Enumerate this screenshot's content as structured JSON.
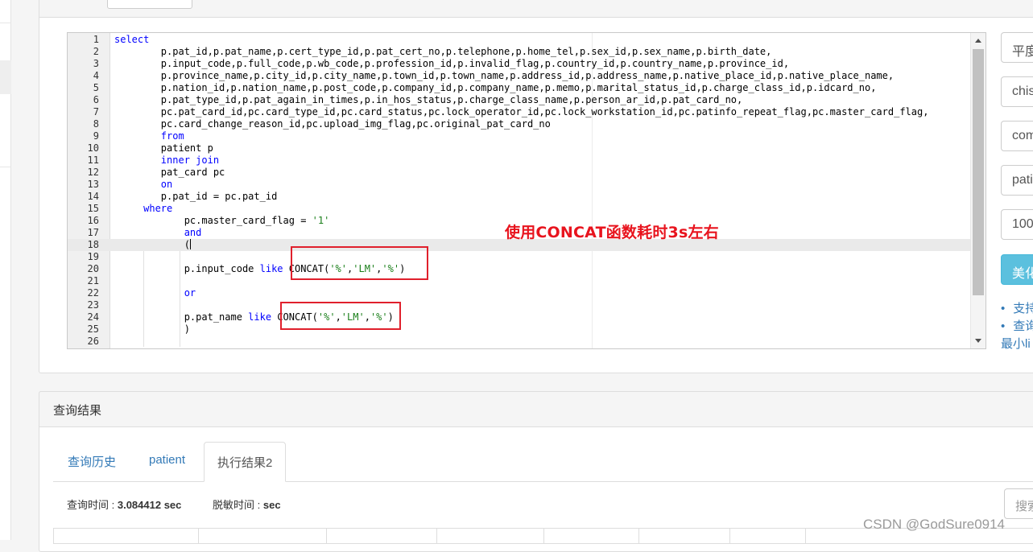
{
  "editor": {
    "lines": [
      {
        "num": "1",
        "tokens": [
          {
            "t": "kw",
            "v": "select"
          }
        ]
      },
      {
        "num": "2",
        "tokens": [
          {
            "t": "plain",
            "v": "        p.pat_id,p.pat_name,p.cert_type_id,p.pat_cert_no,p.telephone,p.home_tel,p.sex_id,p.sex_name,p.birth_date,"
          }
        ]
      },
      {
        "num": "3",
        "tokens": [
          {
            "t": "plain",
            "v": "        p.input_code,p.full_code,p.wb_code,p.profession_id,p.invalid_flag,p.country_id,p.country_name,p.province_id,"
          }
        ]
      },
      {
        "num": "4",
        "tokens": [
          {
            "t": "plain",
            "v": "        p.province_name,p.city_id,p.city_name,p.town_id,p.town_name,p.address_id,p.address_name,p.native_place_id,p.native_place_name,"
          }
        ]
      },
      {
        "num": "5",
        "tokens": [
          {
            "t": "plain",
            "v": "        p.nation_id,p.nation_name,p.post_code,p.company_id,p.company_name,p.memo,p.marital_status_id,p.charge_class_id,p.idcard_no,"
          }
        ]
      },
      {
        "num": "6",
        "tokens": [
          {
            "t": "plain",
            "v": "        p.pat_type_id,p.pat_again_in_times,p.in_hos_status,p.charge_class_name,p.person_ar_id,p.pat_card_no,"
          }
        ]
      },
      {
        "num": "7",
        "tokens": [
          {
            "t": "plain",
            "v": "        pc.pat_card_id,pc.card_type_id,pc.card_status,pc.lock_operator_id,pc.lock_workstation_id,pc.patinfo_repeat_flag,pc.master_card_flag,"
          }
        ]
      },
      {
        "num": "8",
        "tokens": [
          {
            "t": "plain",
            "v": "        pc.card_change_reason_id,pc.upload_img_flag,pc.original_pat_card_no"
          }
        ]
      },
      {
        "num": "9",
        "tokens": [
          {
            "t": "plain",
            "v": "        "
          },
          {
            "t": "kw",
            "v": "from"
          }
        ]
      },
      {
        "num": "10",
        "tokens": [
          {
            "t": "plain",
            "v": "        patient p"
          }
        ]
      },
      {
        "num": "11",
        "tokens": [
          {
            "t": "plain",
            "v": "        "
          },
          {
            "t": "kw",
            "v": "inner join"
          }
        ]
      },
      {
        "num": "12",
        "tokens": [
          {
            "t": "plain",
            "v": "        pat_card pc"
          }
        ]
      },
      {
        "num": "13",
        "tokens": [
          {
            "t": "plain",
            "v": "        "
          },
          {
            "t": "kw",
            "v": "on"
          }
        ]
      },
      {
        "num": "14",
        "tokens": [
          {
            "t": "plain",
            "v": "        p.pat_id = pc.pat_id"
          }
        ]
      },
      {
        "num": "15",
        "tokens": [
          {
            "t": "plain",
            "v": "     "
          },
          {
            "t": "kw",
            "v": "where"
          }
        ]
      },
      {
        "num": "16",
        "tokens": [
          {
            "t": "plain",
            "v": "            pc.master_card_flag = "
          },
          {
            "t": "str",
            "v": "'1'"
          }
        ]
      },
      {
        "num": "17",
        "tokens": [
          {
            "t": "plain",
            "v": "            "
          },
          {
            "t": "kw",
            "v": "and"
          }
        ]
      },
      {
        "num": "18",
        "tokens": [
          {
            "t": "plain",
            "v": "            ("
          },
          {
            "t": "cursor",
            "v": ""
          }
        ]
      },
      {
        "num": "19",
        "tokens": [
          {
            "t": "plain",
            "v": ""
          }
        ]
      },
      {
        "num": "20",
        "tokens": [
          {
            "t": "plain",
            "v": "            p.input_code "
          },
          {
            "t": "kw",
            "v": "like"
          },
          {
            "t": "plain",
            "v": " CONCAT("
          },
          {
            "t": "str",
            "v": "'%'"
          },
          {
            "t": "plain",
            "v": ","
          },
          {
            "t": "str",
            "v": "'LM'"
          },
          {
            "t": "plain",
            "v": ","
          },
          {
            "t": "str",
            "v": "'%'"
          },
          {
            "t": "plain",
            "v": ")"
          }
        ]
      },
      {
        "num": "21",
        "tokens": [
          {
            "t": "plain",
            "v": ""
          }
        ]
      },
      {
        "num": "22",
        "tokens": [
          {
            "t": "plain",
            "v": "            "
          },
          {
            "t": "kw",
            "v": "or"
          }
        ]
      },
      {
        "num": "23",
        "tokens": [
          {
            "t": "plain",
            "v": ""
          }
        ]
      },
      {
        "num": "24",
        "tokens": [
          {
            "t": "plain",
            "v": "            p.pat_name "
          },
          {
            "t": "kw",
            "v": "like"
          },
          {
            "t": "plain",
            "v": " CONCAT("
          },
          {
            "t": "str",
            "v": "'%'"
          },
          {
            "t": "plain",
            "v": ","
          },
          {
            "t": "str",
            "v": "'LM'"
          },
          {
            "t": "plain",
            "v": ","
          },
          {
            "t": "str",
            "v": "'%'"
          },
          {
            "t": "plain",
            "v": ")"
          }
        ]
      },
      {
        "num": "25",
        "tokens": [
          {
            "t": "plain",
            "v": "            )"
          }
        ]
      },
      {
        "num": "26",
        "tokens": [
          {
            "t": "plain",
            "v": ""
          }
        ]
      }
    ],
    "active_line": 18
  },
  "annotation": {
    "text": "使用CONCAT函数耗时3s左右",
    "color": "#e8141e"
  },
  "side_panel": {
    "fields": [
      "平度",
      "chis",
      "com",
      "pati",
      "100"
    ],
    "beautify_button": "美化",
    "list_items": [
      "支持",
      "查询"
    ],
    "footnote": "最小li"
  },
  "results": {
    "title": "查询结果",
    "tabs": [
      "查询历史",
      "patient",
      "执行结果2"
    ],
    "active_tab": 2,
    "query_time_label": "查询时间 :",
    "query_time_value": "3.084412 sec",
    "desensitize_label": "脱敏时间 :",
    "desensitize_value": "sec",
    "search_placeholder": "搜索"
  },
  "watermark": "CSDN @GodSure0914"
}
